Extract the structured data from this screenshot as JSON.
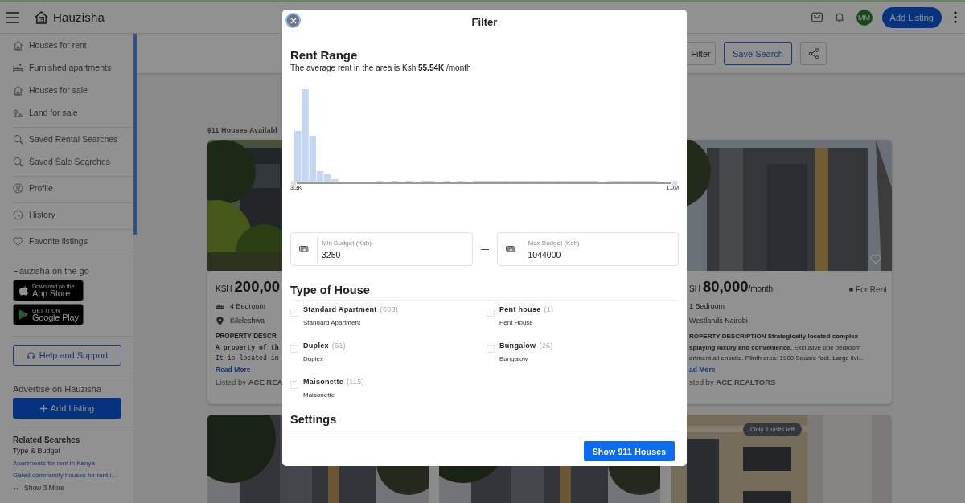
{
  "header": {
    "brand": "Hauzisha",
    "avatar": "MM",
    "add_listing": "Add Listing"
  },
  "sidebar": {
    "nav_groups": [
      [
        {
          "label": "Houses for rent"
        },
        {
          "label": "Furnished apartments"
        },
        {
          "label": "Houses for sale"
        },
        {
          "label": "Land for sale"
        }
      ],
      [
        {
          "label": "Saved Rental Searches"
        },
        {
          "label": "Saved Sale Searches"
        }
      ],
      [
        {
          "label": "Profile"
        }
      ],
      [
        {
          "label": "History"
        }
      ],
      [
        {
          "label": "Favorite listings"
        }
      ]
    ],
    "apps": {
      "heading": "Hauzisha on the go",
      "stores": [
        {
          "kind": "apple",
          "small": "Download on the",
          "large": "App Store"
        },
        {
          "kind": "google",
          "small": "GET IT ON",
          "large": "Google Play"
        }
      ]
    },
    "help_button": "Help and Support",
    "advertise": {
      "heading": "Advertise on Hauzisha",
      "button": "Add Listing"
    },
    "related": {
      "heading": "Related Searches",
      "subheading": "Type & Budget",
      "links": [
        "Apartments for rent in Kenya",
        "Gated community houses for rent i…"
      ],
      "show_more": "Show 3 More"
    }
  },
  "toolbar": {
    "filter_button": "Filter",
    "save_search_button": "Save Search"
  },
  "results": {
    "count": "911 Houses Availabl",
    "cards": [
      {
        "kind": "cut-right",
        "currency": "KSH",
        "price": "200,00",
        "bedrooms": "4 Bedroom",
        "location": "Kileleshwa",
        "description": [
          {
            "kind": "bold",
            "text": "PROPERTY DESCR"
          },
          {
            "kind": "mono-bold",
            "text": "A property of th"
          },
          {
            "kind": "mono",
            "text": "It is located in"
          }
        ],
        "read_more": "Read More",
        "listed_by": "Listed by **ACE REA**"
      },
      {
        "kind": "cut-left",
        "currency": "SH",
        "price": "80,000",
        "period": "/month",
        "status": "For Rent",
        "bedrooms": "1 Bedroom",
        "location": "Westlands Nairobi",
        "description": [
          {
            "kind": "bold",
            "text": "ROPERTY DESCRIPTION Strategically located complex"
          },
          {
            "kind": "plain",
            "text": "**splaying luxury and convenience.** Exclusive one bedroom"
          },
          {
            "kind": "plain",
            "text": "artment all ensuite. Plinth area: 1900 Square feet. Large livi…"
          }
        ],
        "read_more": "ad More",
        "listed_by": "sted by **ACE REALTORS**"
      }
    ],
    "second_row": [
      {
        "kind": "picture"
      },
      {
        "kind": "picture"
      },
      {
        "kind": "picture",
        "badge": "Only 1 units left"
      }
    ]
  },
  "modal": {
    "title": "Filter",
    "rent_range": {
      "heading": "Rent Range",
      "summary": "The average rent in the area is Ksh **55.54K** /month",
      "min_label": "3.3K",
      "max_label": "1.0M"
    },
    "min_field": {
      "label": "Min Budget (Ksh)",
      "value": "3250"
    },
    "max_field": {
      "label": "Max Budget (Ksh)",
      "value": "1044000"
    },
    "house_types": {
      "heading": "Type of House",
      "options": [
        {
          "name": "Standard Apartment",
          "count": "(683)",
          "subtitle": "Standard Apartment",
          "checked": false
        },
        {
          "name": "Pent house",
          "count": "(1)",
          "subtitle": "Pent House",
          "checked": false
        },
        {
          "name": "Duplex",
          "count": "(61)",
          "subtitle": "Duplex",
          "checked": false
        },
        {
          "name": "Bungalow",
          "count": "(26)",
          "subtitle": "Bungalow",
          "checked": false
        },
        {
          "name": "Maisonette",
          "count": "(115)",
          "subtitle": "Maisonette",
          "checked": false
        }
      ]
    },
    "settings_heading": "Settings",
    "submit": "Show 911 Houses"
  }
}
